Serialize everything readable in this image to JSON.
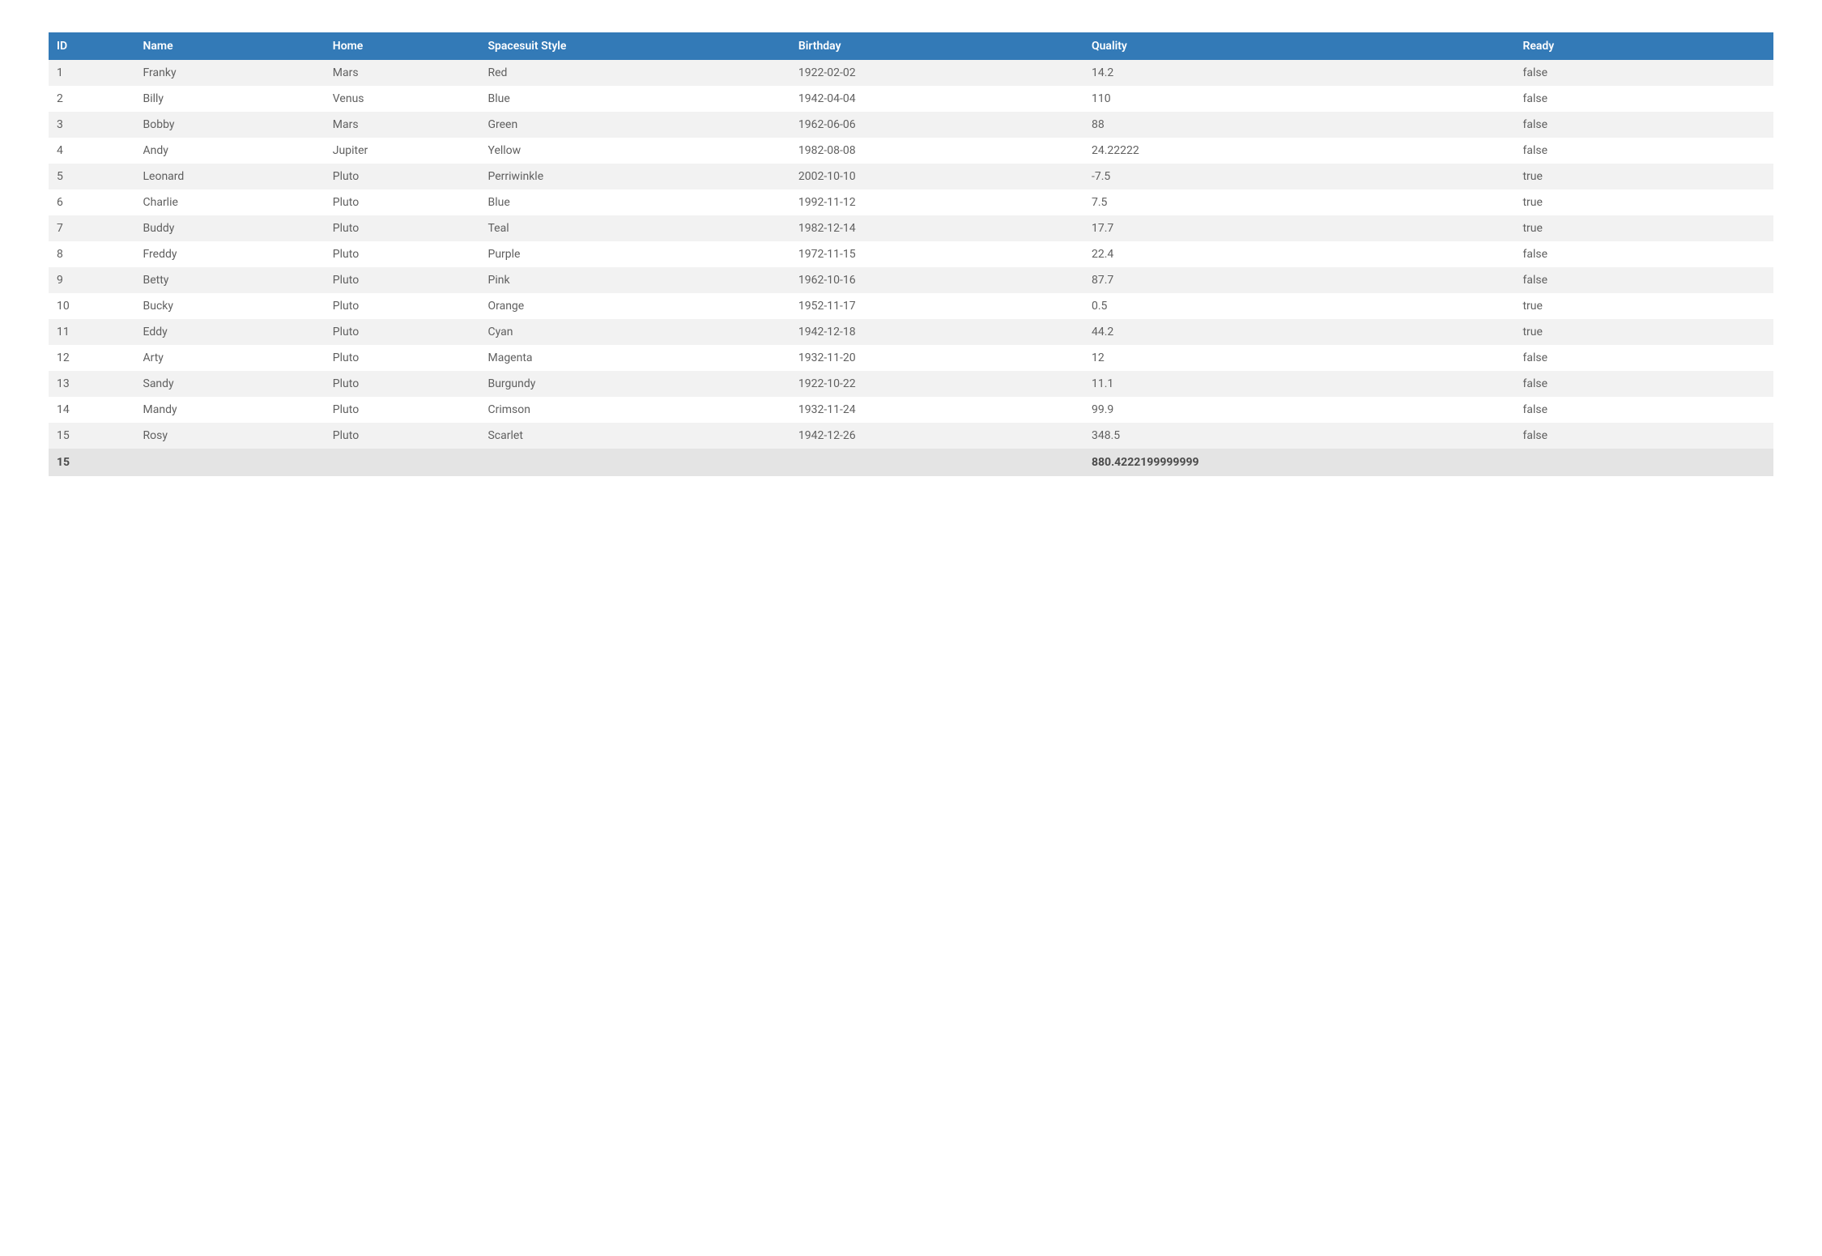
{
  "table": {
    "headers": {
      "id": "ID",
      "name": "Name",
      "home": "Home",
      "spacesuit": "Spacesuit Style",
      "birthday": "Birthday",
      "quality": "Quality",
      "ready": "Ready"
    },
    "rows": [
      {
        "id": "1",
        "name": "Franky",
        "home": "Mars",
        "spacesuit": "Red",
        "birthday": "1922-02-02",
        "quality": "14.2",
        "ready": "false"
      },
      {
        "id": "2",
        "name": "Billy",
        "home": "Venus",
        "spacesuit": "Blue",
        "birthday": "1942-04-04",
        "quality": "110",
        "ready": "false"
      },
      {
        "id": "3",
        "name": "Bobby",
        "home": "Mars",
        "spacesuit": "Green",
        "birthday": "1962-06-06",
        "quality": "88",
        "ready": "false"
      },
      {
        "id": "4",
        "name": "Andy",
        "home": "Jupiter",
        "spacesuit": "Yellow",
        "birthday": "1982-08-08",
        "quality": "24.22222",
        "ready": "false"
      },
      {
        "id": "5",
        "name": "Leonard",
        "home": "Pluto",
        "spacesuit": "Perriwinkle",
        "birthday": "2002-10-10",
        "quality": "-7.5",
        "ready": "true"
      },
      {
        "id": "6",
        "name": "Charlie",
        "home": "Pluto",
        "spacesuit": "Blue",
        "birthday": "1992-11-12",
        "quality": "7.5",
        "ready": "true"
      },
      {
        "id": "7",
        "name": "Buddy",
        "home": "Pluto",
        "spacesuit": "Teal",
        "birthday": "1982-12-14",
        "quality": "17.7",
        "ready": "true"
      },
      {
        "id": "8",
        "name": "Freddy",
        "home": "Pluto",
        "spacesuit": "Purple",
        "birthday": "1972-11-15",
        "quality": "22.4",
        "ready": "false"
      },
      {
        "id": "9",
        "name": "Betty",
        "home": "Pluto",
        "spacesuit": "Pink",
        "birthday": "1962-10-16",
        "quality": "87.7",
        "ready": "false"
      },
      {
        "id": "10",
        "name": "Bucky",
        "home": "Pluto",
        "spacesuit": "Orange",
        "birthday": "1952-11-17",
        "quality": "0.5",
        "ready": "true"
      },
      {
        "id": "11",
        "name": "Eddy",
        "home": "Pluto",
        "spacesuit": "Cyan",
        "birthday": "1942-12-18",
        "quality": "44.2",
        "ready": "true"
      },
      {
        "id": "12",
        "name": "Arty",
        "home": "Pluto",
        "spacesuit": "Magenta",
        "birthday": "1932-11-20",
        "quality": "12",
        "ready": "false"
      },
      {
        "id": "13",
        "name": "Sandy",
        "home": "Pluto",
        "spacesuit": "Burgundy",
        "birthday": "1922-10-22",
        "quality": "11.1",
        "ready": "false"
      },
      {
        "id": "14",
        "name": "Mandy",
        "home": "Pluto",
        "spacesuit": "Crimson",
        "birthday": "1932-11-24",
        "quality": "99.9",
        "ready": "false"
      },
      {
        "id": "15",
        "name": "Rosy",
        "home": "Pluto",
        "spacesuit": "Scarlet",
        "birthday": "1942-12-26",
        "quality": "348.5",
        "ready": "false"
      }
    ],
    "footer": {
      "count": "15",
      "quality_sum": "880.4222199999999"
    }
  }
}
